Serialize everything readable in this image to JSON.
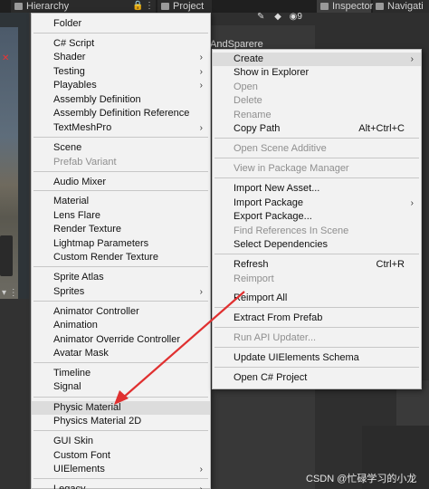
{
  "tabs": {
    "hierarchy": "Hierarchy",
    "project": "Project",
    "inspector": "Inspector",
    "navigation": "Navigati"
  },
  "window_controls": {
    "lock": "🔒",
    "menu": "⋮"
  },
  "toolbar": {
    "badge_count": "9"
  },
  "scene": {
    "name_fragment": "AndSparere"
  },
  "create_menu": {
    "items": [
      {
        "label": "Folder"
      },
      {
        "label": "C# Script"
      },
      {
        "label": "Shader",
        "submenu": true
      },
      {
        "label": "Testing",
        "submenu": true
      },
      {
        "label": "Playables",
        "submenu": true
      },
      {
        "label": "Assembly Definition"
      },
      {
        "label": "Assembly Definition Reference"
      },
      {
        "label": "TextMeshPro",
        "submenu": true
      },
      {
        "label": "Scene"
      },
      {
        "label": "Prefab Variant",
        "disabled": true
      },
      {
        "label": "Audio Mixer"
      },
      {
        "label": "Material"
      },
      {
        "label": "Lens Flare"
      },
      {
        "label": "Render Texture"
      },
      {
        "label": "Lightmap Parameters"
      },
      {
        "label": "Custom Render Texture"
      },
      {
        "label": "Sprite Atlas"
      },
      {
        "label": "Sprites",
        "submenu": true
      },
      {
        "label": "Animator Controller"
      },
      {
        "label": "Animation"
      },
      {
        "label": "Animator Override Controller"
      },
      {
        "label": "Avatar Mask"
      },
      {
        "label": "Timeline"
      },
      {
        "label": "Signal"
      },
      {
        "label": "Physic Material",
        "highlighted": true
      },
      {
        "label": "Physics Material 2D"
      },
      {
        "label": "GUI Skin"
      },
      {
        "label": "Custom Font"
      },
      {
        "label": "UIElements",
        "submenu": true
      },
      {
        "label": "Legacy",
        "submenu": true
      }
    ]
  },
  "context_menu": {
    "items": [
      {
        "label": "Create",
        "submenu": true,
        "highlighted": true
      },
      {
        "label": "Show in Explorer"
      },
      {
        "label": "Open",
        "disabled": true
      },
      {
        "label": "Delete",
        "disabled": true
      },
      {
        "label": "Rename",
        "disabled": true
      },
      {
        "label": "Copy Path",
        "shortcut": "Alt+Ctrl+C"
      },
      {
        "label": "Open Scene Additive",
        "disabled": true
      },
      {
        "label": "View in Package Manager",
        "disabled": true
      },
      {
        "label": "Import New Asset..."
      },
      {
        "label": "Import Package",
        "submenu": true
      },
      {
        "label": "Export Package..."
      },
      {
        "label": "Find References In Scene",
        "disabled": true
      },
      {
        "label": "Select Dependencies"
      },
      {
        "label": "Refresh",
        "shortcut": "Ctrl+R"
      },
      {
        "label": "Reimport",
        "disabled": true
      },
      {
        "label": "Reimport All"
      },
      {
        "label": "Extract From Prefab"
      },
      {
        "label": "Run API Updater...",
        "disabled": true
      },
      {
        "label": "Update UIElements Schema"
      },
      {
        "label": "Open C# Project"
      }
    ]
  },
  "annotation": {
    "arrow_color": "#e03030"
  },
  "watermark": "CSDN @忙碌学习的小龙"
}
